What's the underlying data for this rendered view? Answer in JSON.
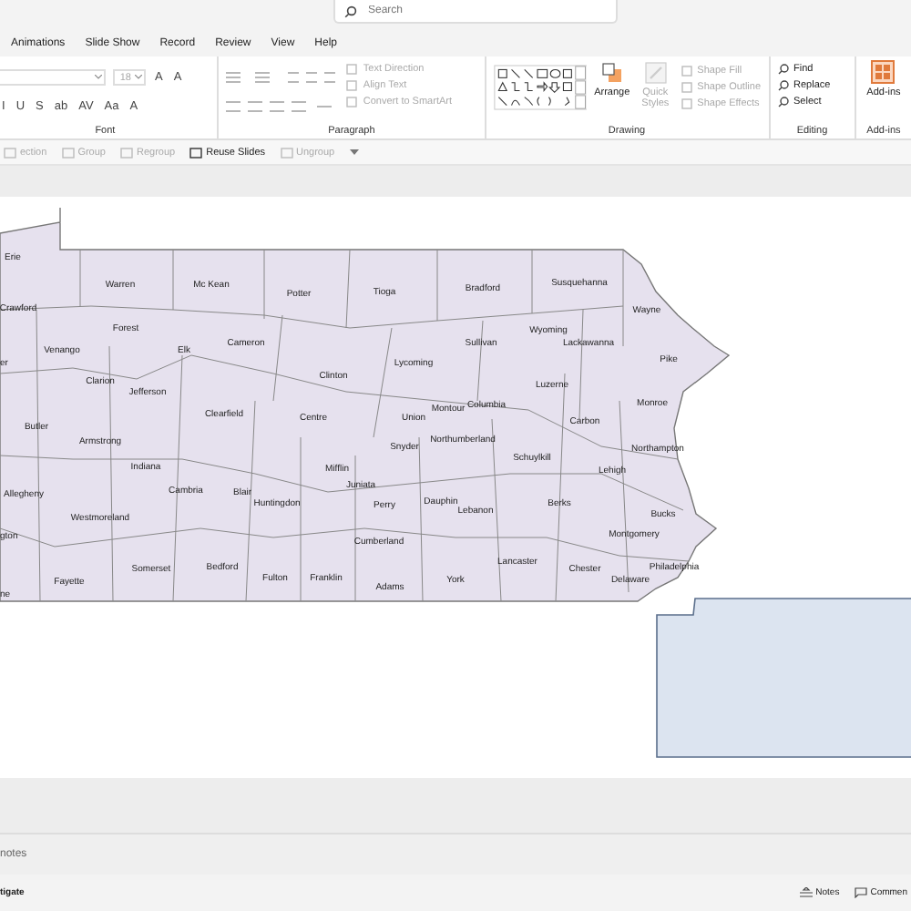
{
  "search": {
    "placeholder": "Search"
  },
  "tabs": [
    {
      "label": "Animations",
      "selected": false
    },
    {
      "label": "Slide Show",
      "selected": false
    },
    {
      "label": "Record",
      "selected": false
    },
    {
      "label": "Review",
      "selected": false
    },
    {
      "label": "View",
      "selected": false
    },
    {
      "label": "Help",
      "selected": false
    }
  ],
  "font": {
    "size": "18",
    "buttons": [
      "A",
      "A",
      "I",
      "U",
      "S",
      "ab",
      "AV",
      "Aa",
      "A"
    ],
    "label": "Font"
  },
  "paragraph": {
    "commands": [
      {
        "label": "Text Direction",
        "disabled": true
      },
      {
        "label": "Align Text",
        "disabled": true
      },
      {
        "label": "Convert to SmartArt",
        "disabled": true
      }
    ],
    "label": "Paragraph"
  },
  "drawing": {
    "arrange": {
      "label": "Arrange",
      "disabled": false
    },
    "quick_styles": {
      "label": "Quick Styles",
      "disabled": true
    },
    "commands": [
      {
        "label": "Shape Fill",
        "disabled": true
      },
      {
        "label": "Shape Outline",
        "disabled": true
      },
      {
        "label": "Shape Effects",
        "disabled": true
      }
    ],
    "label": "Drawing"
  },
  "editing": {
    "commands": [
      {
        "label": "Find",
        "disabled": false
      },
      {
        "label": "Replace",
        "disabled": false
      },
      {
        "label": "Select",
        "disabled": false
      }
    ],
    "label": "Editing"
  },
  "add_ins": {
    "button": "Add-ins",
    "label": "Add-ins"
  },
  "quick_bar": [
    {
      "label": "ection",
      "disabled": true
    },
    {
      "label": "Group",
      "disabled": true
    },
    {
      "label": "Regroup",
      "disabled": true
    },
    {
      "label": "Reuse Slides",
      "disabled": false
    },
    {
      "label": "Ungroup",
      "disabled": true
    }
  ],
  "counties": [
    "Erie",
    "Warren",
    "Mc Kean",
    "Potter",
    "Tioga",
    "Bradford",
    "Susquehanna",
    "Wayne",
    "Crawford",
    "Forest",
    "Elk",
    "Cameron",
    "Clinton",
    "Lycoming",
    "Sullivan",
    "Wyoming",
    "Lackawanna",
    "Pike",
    "Venango",
    "er",
    "Clarion",
    "Jefferson",
    "Clearfield",
    "Centre",
    "Luzerne",
    "Monroe",
    "Union",
    "Montour",
    "Columbia",
    "Carbon",
    "Butler",
    "Armstrong",
    "Indiana",
    "Snyder",
    "Northumberland",
    "Schuylkill",
    "Northampton",
    "Mifflin",
    "Lehigh",
    "Juniata",
    "Cambria",
    "Blair",
    "Huntingdon",
    "Perry",
    "Dauphin",
    "Lebanon",
    "Berks",
    "Bucks",
    "Allegheny",
    "Westmoreland",
    "gton",
    "Cumberland",
    "Montgomery",
    "Somerset",
    "Bedford",
    "Lancaster",
    "Chester",
    "Philadelphia",
    "Fayette",
    "Fulton",
    "Franklin",
    "Adams",
    "York",
    "Delaware",
    "ne"
  ],
  "notes": {
    "placeholder": "notes"
  },
  "status_bar": {
    "left": "tigate",
    "notes": "Notes",
    "comments": "Commen"
  }
}
